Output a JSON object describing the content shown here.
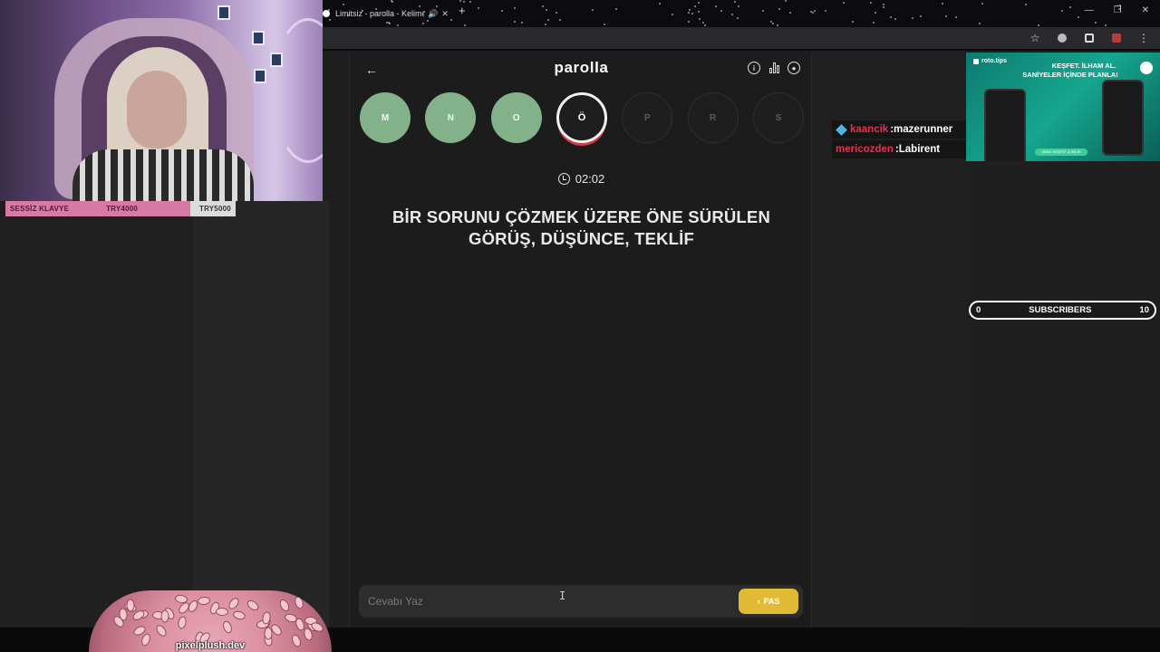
{
  "browser": {
    "tab_title": "Limitsiz - parolla - Kelime o",
    "tab_audio_icon": "speaker-icon",
    "tab_close": "✕",
    "new_tab": "+"
  },
  "goal_bar": {
    "name": "SESSİZ KLAVYE",
    "current": "TRY4000",
    "target": "TRY5000"
  },
  "game": {
    "logo": "parolla",
    "back_icon": "←",
    "letters": [
      {
        "char": "M",
        "state": "done"
      },
      {
        "char": "N",
        "state": "done"
      },
      {
        "char": "O",
        "state": "done"
      },
      {
        "char": "Ö",
        "state": "current"
      },
      {
        "char": "P",
        "state": "pending"
      },
      {
        "char": "R",
        "state": "pending"
      },
      {
        "char": "S",
        "state": "pending"
      }
    ],
    "timer": "02:02",
    "question": "BİR SORUNU ÇÖZMEK ÜZERE ÖNE SÜRÜLEN GÖRÜŞ, DÜŞÜNCE, TEKLİF",
    "answer_placeholder": "Cevabı Yaz",
    "pass_label": "PAS",
    "colors": {
      "done": "#83b28a",
      "current_ring": "#f1f1f1",
      "current_underline": "#d1394b",
      "pass_button": "#e2bb34"
    }
  },
  "chat": [
    {
      "user": "kaancik",
      "message": "mazerunner",
      "user_color": "#e5334f",
      "badge": true
    },
    {
      "user": "mericozden",
      "message": "Labirent",
      "user_color": "#e5334f",
      "badge": false
    }
  ],
  "ad": {
    "brand": "roto.tips",
    "headline1": "KEŞFET. İLHAM AL.",
    "headline2": "SANİYELER İÇİNDE PLANLA!",
    "cta": "ŞİMDİ KEŞFET & İNDİR"
  },
  "subscribers": {
    "current": "0",
    "label": "SUBSCRIBERS",
    "goal": "10"
  },
  "watermark": "pixelplush.dev"
}
